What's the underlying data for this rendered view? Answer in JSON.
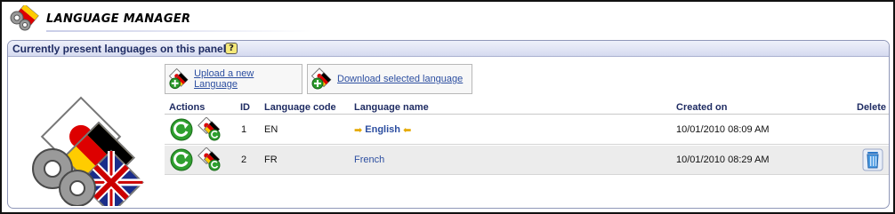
{
  "header": {
    "title": "LANGUAGE MANAGER"
  },
  "panel": {
    "title": "Currently present languages on this panel",
    "help_label": "?"
  },
  "toolbar": {
    "upload_label": "Upload a new Language",
    "download_label": "Download selected language"
  },
  "table": {
    "columns": {
      "actions": "Actions",
      "id": "ID",
      "code": "Language code",
      "name": "Language name",
      "created": "Created on",
      "delete": "Delete"
    },
    "rows": [
      {
        "id": "1",
        "code": "EN",
        "name": "English",
        "created": "10/01/2010 08:09 AM",
        "current": true
      },
      {
        "id": "2",
        "code": "FR",
        "name": "French",
        "created": "10/01/2010 08:29 AM",
        "current": false
      }
    ]
  },
  "colors": {
    "accent": "#2c4ea0",
    "title_text": "#1f2c63",
    "panel_border": "#8f97b8",
    "row_alt": "#ececec"
  },
  "icons": {
    "header": "language-gear-flags-icon",
    "upload": "flags-plus-icon",
    "download": "flags-plus-icon",
    "refresh": "green-refresh-icon",
    "translate": "flags-refresh-icon",
    "delete": "trash-can-icon",
    "current_marker": "yellow-arrow-icon"
  }
}
